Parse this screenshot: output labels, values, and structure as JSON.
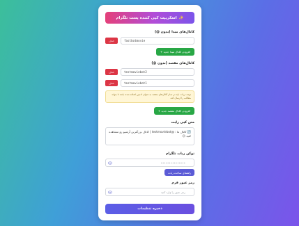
{
  "header": {
    "icon": "sparkles-icon",
    "title": "اسکریپت کپی کننده پست تلگرام"
  },
  "source": {
    "title": "کانال‌های مبدا (بدون @)",
    "channels": [
      "fastbotmovie"
    ],
    "delete_label": "حذف",
    "add_label": "+ افزودن کانال مبدا جدید"
  },
  "dest": {
    "title": "کانال‌های مقصد (بدون @)",
    "channels": [
      "testmoviebot2",
      "testmoviebot1"
    ],
    "delete_label": "حذف",
    "note": "توجه: ربات باید در تمام کانال‌های مقصد به عنوان ادمین اضافه شده باشد تا بتواند مطالب را ارسال کند.",
    "add_label": "+ افزودن کانال مقصد جدید"
  },
  "caption": {
    "title": "متن کپی رایت",
    "value": "🔄 کانال ما : @testmoviebot | کانال بزرگترین آرشیو رو مشاهده کنید 😊"
  },
  "token": {
    "title": "توکن ربات تلگرام",
    "value": "•••••••••••••••",
    "guide_label": "راهنمای ساخت ربات"
  },
  "password": {
    "title": "رمز عبور فرم",
    "placeholder": "رمز عبور را وارد کنید"
  },
  "save_label": "ذخیره تنظیمات"
}
